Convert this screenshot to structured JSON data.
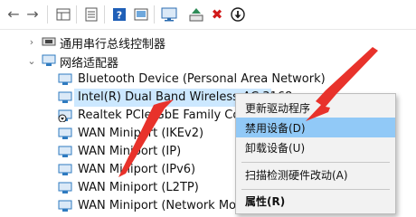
{
  "toolbar": {
    "buttons": [
      {
        "name": "back-arrow-icon",
        "glyph": "←",
        "color": "#5b5b5b"
      },
      {
        "name": "forward-arrow-icon",
        "glyph": "→",
        "color": "#5b5b5b"
      },
      {
        "name": "properties-grid-icon",
        "glyph": "▦",
        "color": "#4f4f4f"
      },
      {
        "name": "document-list-icon",
        "glyph": "▤",
        "color": "#4f4f4f"
      },
      {
        "name": "help-icon",
        "glyph": "?",
        "color": "#1f5fb7"
      },
      {
        "name": "device-console-icon",
        "glyph": "▣",
        "color": "#4f4f4f"
      },
      {
        "name": "monitor-scan-icon",
        "glyph": "▭",
        "color": "#2b6cb0"
      },
      {
        "name": "update-driver-icon",
        "glyph": "▲",
        "color": "#2e8b57"
      },
      {
        "name": "uninstall-x-icon",
        "glyph": "✖",
        "color": "#d11a1a"
      },
      {
        "name": "download-circle-icon",
        "glyph": "⬇",
        "color": "#1a1a1a"
      }
    ]
  },
  "tree": {
    "rows": [
      {
        "label": "通用串行总线控制器",
        "expander": "›"
      },
      {
        "label": "网络适配器",
        "expander": "⌄"
      },
      {
        "label": "Bluetooth Device (Personal Area Network)"
      },
      {
        "label": "Intel(R) Dual Band Wireless-AC 3168"
      },
      {
        "label": "Realtek PCIe GbE Family Controller"
      },
      {
        "label": "WAN Miniport (IKEv2)"
      },
      {
        "label": "WAN Miniport (IP)"
      },
      {
        "label": "WAN Miniport (IPv6)"
      },
      {
        "label": "WAN Miniport (L2TP)"
      },
      {
        "label": "WAN Miniport (Network Monitor)"
      }
    ]
  },
  "context_menu": {
    "update_driver": "更新驱动程序",
    "disable_device": "禁用设备(D)",
    "uninstall_device": "卸载设备(U)",
    "scan_hardware": "扫描检测硬件改动(A)",
    "properties": "属性(R)"
  },
  "colors": {
    "selection": "#cce8ff",
    "menu_highlight": "#91c9f7",
    "annotation_arrow": "#e8322b",
    "network_icon": "#2f7bc0"
  }
}
